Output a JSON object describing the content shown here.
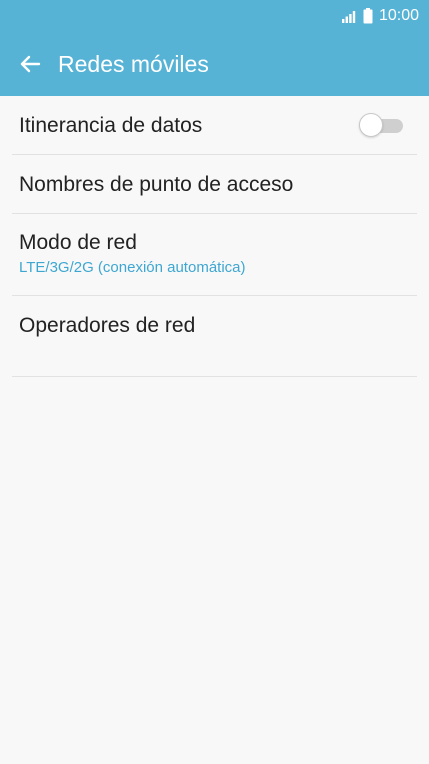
{
  "colors": {
    "header": "#57b3d6",
    "background": "#f8f8f8",
    "primary_text": "#222222",
    "summary_text": "#3ea7d1",
    "divider": "#e2e2e2"
  },
  "status_bar": {
    "time": "10:00",
    "icons": [
      "signal-icon",
      "battery-icon"
    ]
  },
  "app_bar": {
    "back_icon": "arrow-left-icon",
    "title": "Redes móviles"
  },
  "settings": {
    "items": [
      {
        "title": "Itinerancia de datos",
        "toggle": "off"
      },
      {
        "title": "Nombres de punto de acceso"
      },
      {
        "title": "Modo de red",
        "summary": "LTE/3G/2G (conexión automática)"
      },
      {
        "title": "Operadores de red"
      }
    ]
  }
}
